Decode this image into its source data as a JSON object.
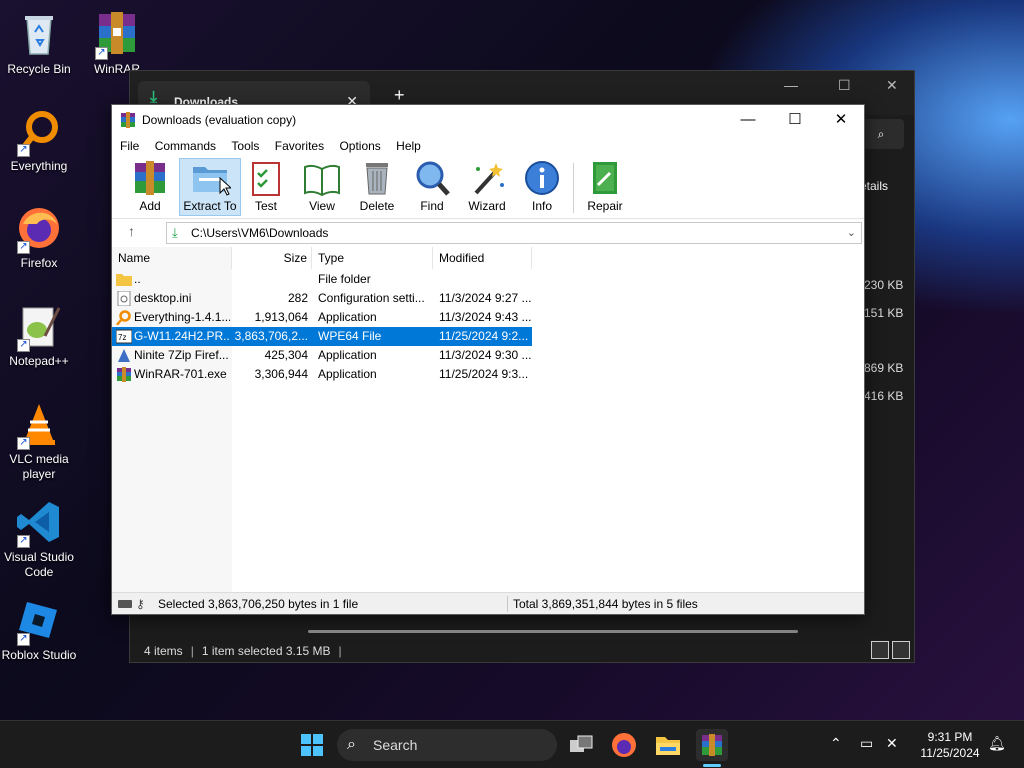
{
  "desktop": {
    "icons": [
      {
        "label": "Recycle Bin",
        "icon": "recycle-bin-icon"
      },
      {
        "label": "WinRAR",
        "icon": "winrar-icon"
      },
      {
        "label": "Everything",
        "icon": "everything-icon"
      },
      {
        "label": "Firefox",
        "icon": "firefox-icon"
      },
      {
        "label": "Notepad++",
        "icon": "notepadpp-icon"
      },
      {
        "label": "VLC media player",
        "icon": "vlc-icon"
      },
      {
        "label": "Visual Studio Code",
        "icon": "vscode-icon"
      },
      {
        "label": "Roblox Studio",
        "icon": "roblox-studio-icon"
      }
    ]
  },
  "explorer": {
    "tab_title": "Downloads",
    "details_label": "etails",
    "sizes": [
      "230 KB",
      "151 KB",
      "869 KB",
      "416 KB"
    ],
    "status_items": "4 items",
    "status_selected": "1 item selected  3.15 MB"
  },
  "winrar": {
    "title": "Downloads (evaluation copy)",
    "menu": [
      "File",
      "Commands",
      "Tools",
      "Favorites",
      "Options",
      "Help"
    ],
    "toolbar": [
      {
        "label": "Add",
        "icon": "add-archive-icon"
      },
      {
        "label": "Extract To",
        "icon": "extract-to-icon"
      },
      {
        "label": "Test",
        "icon": "test-icon"
      },
      {
        "label": "View",
        "icon": "view-icon"
      },
      {
        "label": "Delete",
        "icon": "delete-icon"
      },
      {
        "label": "Find",
        "icon": "find-icon"
      },
      {
        "label": "Wizard",
        "icon": "wizard-icon"
      },
      {
        "label": "Info",
        "icon": "info-icon"
      },
      {
        "label": "Repair",
        "icon": "repair-icon"
      }
    ],
    "address": "C:\\Users\\VM6\\Downloads",
    "columns": [
      "Name",
      "Size",
      "Type",
      "Modified"
    ],
    "files": [
      {
        "name": "..",
        "size": "",
        "type": "File folder",
        "modified": "",
        "icon": "folder-icon",
        "selected": false
      },
      {
        "name": "desktop.ini",
        "size": "282",
        "type": "Configuration setti...",
        "modified": "11/3/2024 9:27 ...",
        "icon": "ini-file-icon",
        "selected": false
      },
      {
        "name": "Everything-1.4.1...",
        "size": "1,913,064",
        "type": "Application",
        "modified": "11/3/2024 9:43 ...",
        "icon": "everything-icon",
        "selected": false
      },
      {
        "name": "G-W11.24H2.PR...",
        "size": "3,863,706,2...",
        "type": "WPE64 File",
        "modified": "11/25/2024 9:2...",
        "icon": "7z-icon",
        "selected": true
      },
      {
        "name": "Ninite 7Zip Firef...",
        "size": "425,304",
        "type": "Application",
        "modified": "11/3/2024 9:30 ...",
        "icon": "ninite-icon",
        "selected": false
      },
      {
        "name": "WinRAR-701.exe",
        "size": "3,306,944",
        "type": "Application",
        "modified": "11/25/2024 9:3...",
        "icon": "winrar-icon",
        "selected": false
      }
    ],
    "status_left": "Selected 3,863,706,250 bytes in 1 file",
    "status_right": "Total 3,869,351,844 bytes in 5 files"
  },
  "taskbar": {
    "search_placeholder": "Search",
    "time": "9:31 PM",
    "date": "11/25/2024"
  },
  "colors": {
    "selection": "#0078d7",
    "toolbar_active": "#cce4f7",
    "taskbar_bg": "#1c1c1c"
  }
}
